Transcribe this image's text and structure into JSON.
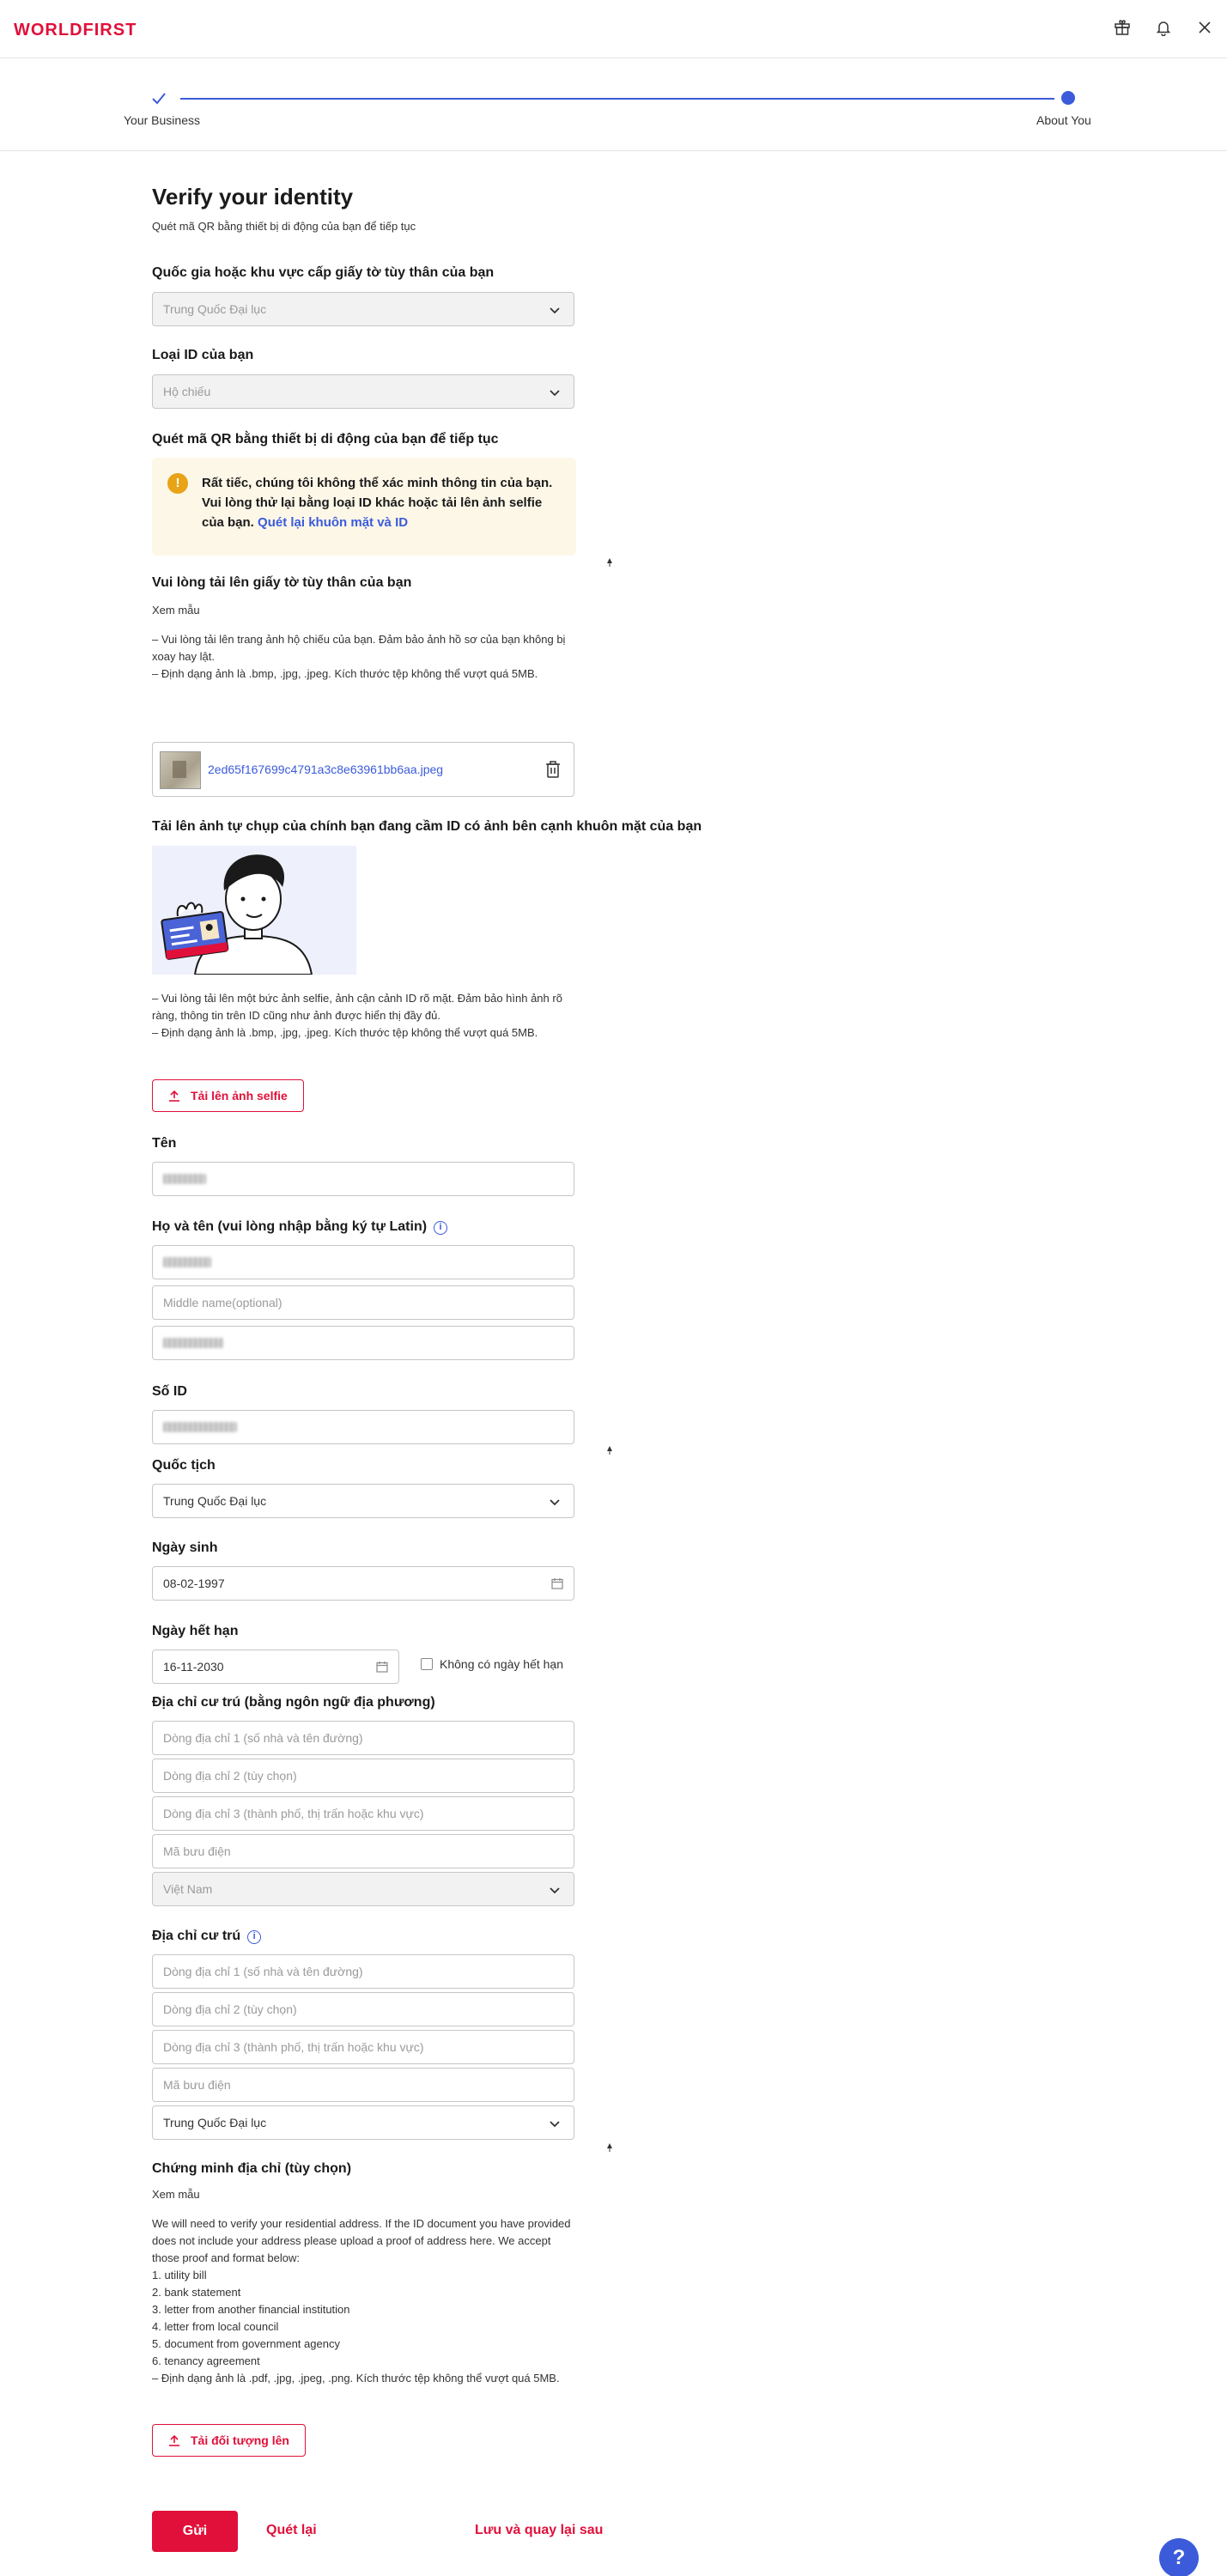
{
  "brand": {
    "logo": "WORLDFIRST"
  },
  "stepper": {
    "step1": "Your Business",
    "step2": "About You"
  },
  "page": {
    "title": "Verify your identity",
    "subtitle": "Quét mã QR bằng thiết bị di động của bạn để tiếp tục"
  },
  "country_issue": {
    "label": "Quốc gia hoặc khu vực cấp giấy tờ tùy thân của bạn",
    "value": "Trung Quốc Đại lục"
  },
  "id_type": {
    "label": "Loại ID của bạn",
    "value": "Hộ chiếu"
  },
  "qr_section": {
    "label": "Quét mã QR bằng thiết bị di động của bạn để tiếp tục"
  },
  "alert": {
    "text": "Rất tiếc, chúng tôi không thể xác minh thông tin của bạn. Vui lòng thử lại bằng loại ID khác hoặc tải lên ảnh selfie của bạn. ",
    "link": "Quét lại khuôn mặt và ID"
  },
  "id_upload": {
    "label": "Vui lòng tải lên giấy tờ tùy thân của bạn",
    "sample_link": "Xem mẫu",
    "note1": "– Vui lòng tải lên trang ảnh hộ chiếu của bạn. Đảm bảo ảnh hồ sơ của bạn không bị xoay hay lật.",
    "note2": "– Định dạng ảnh là .bmp, .jpg, .jpeg. Kích thước tệp không thể vượt quá 5MB.",
    "file_name": "2ed65f167699c4791a3c8e63961bb6aa.jpeg"
  },
  "selfie": {
    "label": "Tải lên ảnh tự chụp của chính bạn đang cầm ID có ảnh bên cạnh khuôn mặt của bạn",
    "note1": "– Vui lòng tải lên một bức ảnh selfie, ảnh cận cảnh ID rõ mặt. Đảm bảo hình ảnh rõ ràng, thông tin trên ID cũng như ảnh được hiển thị đầy đủ.",
    "note2": "– Định dạng ảnh là .bmp, .jpg, .jpeg. Kích thước tệp không thể vượt quá 5MB.",
    "button": "Tải lên ảnh selfie"
  },
  "name": {
    "label": "Tên"
  },
  "latin_name": {
    "label": "Họ và tên (vui lòng nhập bằng ký tự Latin)",
    "middle_placeholder": "Middle name(optional)"
  },
  "id_number": {
    "label": "Số ID"
  },
  "nationality": {
    "label": "Quốc tịch",
    "value": "Trung Quốc Đại lục"
  },
  "dob": {
    "label": "Ngày sinh",
    "value": "08-02-1997"
  },
  "expiry": {
    "label": "Ngày hết hạn",
    "value": "16-11-2030",
    "no_expiry": "Không có ngày hết hạn"
  },
  "local_address": {
    "label": "Địa chỉ cư trú (bằng ngôn ngữ địa phương)",
    "line1": "Dòng địa chỉ 1 (số nhà và tên đường)",
    "line2": "Dòng địa chỉ 2 (tùy chọn)",
    "line3": "Dòng địa chỉ 3 (thành phố, thị trấn hoặc khu vực)",
    "postal": "Mã bưu điện",
    "country": "Việt Nam"
  },
  "address": {
    "label": "Địa chỉ cư trú",
    "line1": "Dòng địa chỉ 1 (số nhà và tên đường)",
    "line2": "Dòng địa chỉ 2 (tùy chọn)",
    "line3": "Dòng địa chỉ 3 (thành phố, thị trấn hoặc khu vực)",
    "postal": "Mã bưu điện",
    "country": "Trung Quốc Đại lục"
  },
  "proof": {
    "label": "Chứng minh địa chỉ (tùy chọn)",
    "sample_link": "Xem mẫu",
    "intro": "We will need to verify your residential address. If the ID document you have provided does not include your address please upload a proof of address here. We accept those proof and format below:",
    "items": [
      "1. utility bill",
      "2. bank statement",
      "3. letter from another financial institution",
      "4. letter from local council",
      "5. document from government agency",
      "6. tenancy agreement"
    ],
    "format": "– Định dạng ảnh là .pdf, .jpg, .jpeg, .png. Kích thước tệp không thể vượt quá 5MB.",
    "button": "Tải đối tượng lên"
  },
  "actions": {
    "submit": "Gửi",
    "rescan": "Quét lại",
    "save_later": "Lưu và quay lại sau"
  },
  "help": {
    "label": "?"
  },
  "colors": {
    "brand_red": "#e0103a",
    "accent_blue": "#3b5bdb",
    "alert_bg": "#fdf7e8",
    "warn_orange": "#e8a317"
  },
  "icons": [
    "gift-icon",
    "bell-icon",
    "close-icon",
    "check-icon",
    "chevron-down-icon",
    "warning-icon",
    "trash-icon",
    "upload-icon",
    "calendar-icon",
    "info-icon",
    "help-icon"
  ]
}
